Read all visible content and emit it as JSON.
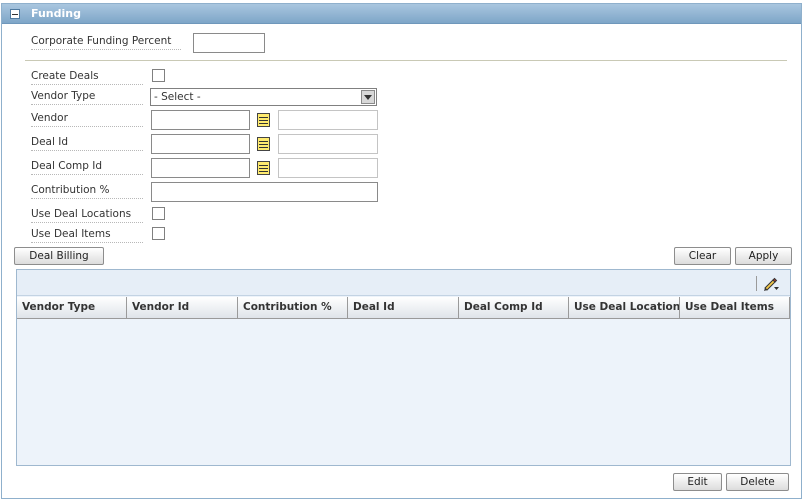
{
  "panel": {
    "title": "Funding"
  },
  "form": {
    "corporate_funding_percent_label": "Corporate Funding Percent",
    "create_deals_label": "Create Deals",
    "vendor_type_label": "Vendor Type",
    "vendor_type_value": "- Select -",
    "vendor_label": "Vendor",
    "deal_id_label": "Deal Id",
    "deal_comp_id_label": "Deal Comp Id",
    "contribution_label": "Contribution %",
    "use_deal_locations_label": "Use Deal Locations",
    "use_deal_items_label": "Use Deal Items"
  },
  "buttons": {
    "deal_billing": "Deal Billing",
    "clear": "Clear",
    "apply": "Apply",
    "edit": "Edit",
    "delete": "Delete"
  },
  "table": {
    "columns": [
      "Vendor Type",
      "Vendor Id",
      "Contribution %",
      "Deal Id",
      "Deal Comp Id",
      "Use Deal Locations",
      "Use Deal Items"
    ],
    "rows": []
  },
  "icons": {
    "collapse": "collapse-icon",
    "lov": "list-of-values-icon",
    "edit_toolbar": "pencil-icon"
  },
  "colors": {
    "header_blue": "#7ea6c8",
    "lov_yellow": "#ffeb6e",
    "grid_bg": "#edf3fa"
  }
}
